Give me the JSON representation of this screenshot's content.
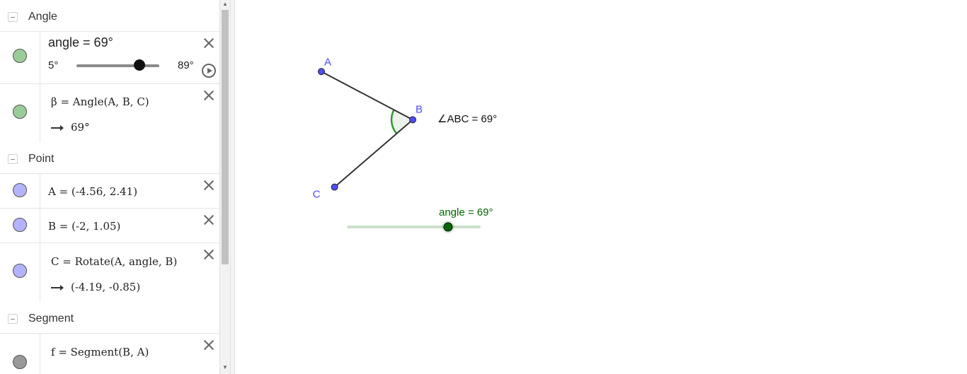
{
  "algebra": {
    "groups": {
      "angle": "Angle",
      "point": "Point",
      "segment": "Segment"
    },
    "slider_row": {
      "label": "angle = 69°",
      "min": "5°",
      "max": "89°",
      "value_fraction": 0.7619
    },
    "beta_row": {
      "definition": "β = Angle(A, B, C)",
      "value": "69°"
    },
    "point_A": {
      "definition": "A = (-4.56, 2.41)"
    },
    "point_B": {
      "definition": "B = (-2, 1.05)"
    },
    "point_C": {
      "definition": "C = Rotate(A, angle, B)",
      "value": "(-4.19, -0.85)"
    },
    "segment_f": {
      "definition": "f = Segment(B, A)"
    }
  },
  "graphics": {
    "points": {
      "A": {
        "label": "A",
        "x": -4.56,
        "y": 2.41
      },
      "B": {
        "label": "B",
        "x": -2,
        "y": 1.05
      },
      "C": {
        "label": "C",
        "x": -4.19,
        "y": -0.85
      }
    },
    "angle_caption": "∠ABC = 69°",
    "slider_caption": "angle = 69°",
    "slider_value_fraction": 0.7619
  },
  "colors": {
    "angle_marble": "#99cc99",
    "point_marble": "#b3b3ff",
    "segment_marble": "#999999",
    "point_fill": "#4d4dff",
    "point_label": "#4d4dff",
    "angle_arc": "#339933",
    "slider_green": "#006600"
  }
}
